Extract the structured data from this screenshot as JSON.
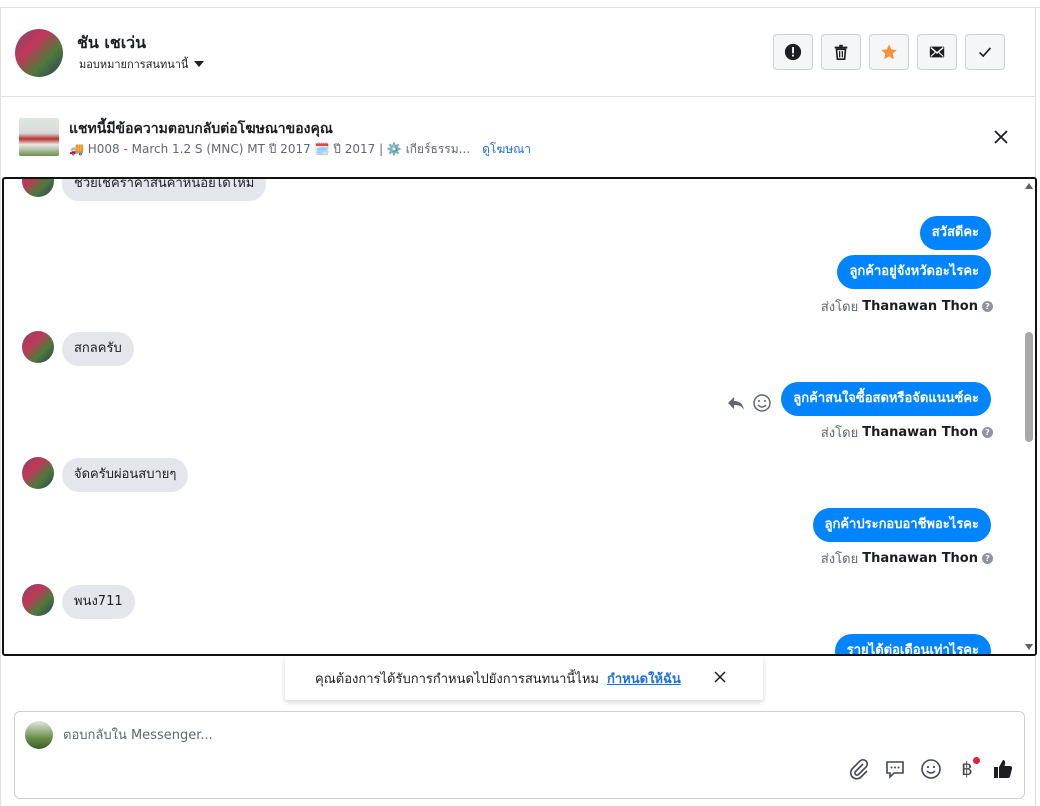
{
  "header": {
    "contact_name": "ชัน เชเว่น",
    "assign_label": "มอบหมายการสนทนานี้",
    "actions": [
      {
        "name": "report-button",
        "icon": "exclamation-circle-icon"
      },
      {
        "name": "delete-button",
        "icon": "trash-icon"
      },
      {
        "name": "star-button",
        "icon": "star-icon",
        "color": "#f7923b"
      },
      {
        "name": "mark-unread-button",
        "icon": "envelope-icon"
      },
      {
        "name": "mark-done-button",
        "icon": "checkmark-icon"
      }
    ]
  },
  "ad_banner": {
    "title": "แชทนี้มีข้อความตอบกลับต่อโฆษณาของคุณ",
    "details": "🚚 H008 - March 1.2 S (MNC) MT ปี 2017 🗓️ ปี 2017 | ⚙️ เกียร์ธรรม...",
    "view_ad_link": "ดูโฆษณา"
  },
  "messages": [
    {
      "direction": "in",
      "text": "ช่วยเช็คราคาสินค้าหน่อยได้ไหม"
    },
    {
      "direction": "out",
      "text": "สวัสดีคะ"
    },
    {
      "direction": "out",
      "text": "ลูกค้าอยู่จังหวัดอะไรคะ"
    },
    {
      "direction": "sent_by",
      "prefix": "ส่งโดย",
      "name": "Thanawan Thon"
    },
    {
      "direction": "in",
      "text": "สกลครับ"
    },
    {
      "direction": "out",
      "text": "ลูกค้าสนใจซื้อสดหรือจัดแนนซ์คะ"
    },
    {
      "direction": "sent_by",
      "prefix": "ส่งโดย",
      "name": "Thanawan Thon"
    },
    {
      "direction": "in",
      "text": "จัดครับผ่อนสบายๆ"
    },
    {
      "direction": "out",
      "text": "ลูกค้าประกอบอาชีพอะไรคะ"
    },
    {
      "direction": "sent_by",
      "prefix": "ส่งโดย",
      "name": "Thanawan Thon"
    },
    {
      "direction": "in",
      "text": "พนง711"
    },
    {
      "direction": "out",
      "text": "รายได้ต่อเดือนเท่าไรคะ"
    }
  ],
  "toast": {
    "text": "คุณต้องการได้รับการกำหนดไปยังการสนทนานี้ไหม",
    "link": "กำหนดให้ฉัน"
  },
  "composer": {
    "placeholder": "ตอบกลับใน Messenger...",
    "value": "",
    "baht_symbol": "฿"
  },
  "colors": {
    "outgoing_bubble": "#0084ff",
    "incoming_bubble": "#e4e6eb",
    "link": "#216fdb",
    "star": "#f7923b"
  }
}
